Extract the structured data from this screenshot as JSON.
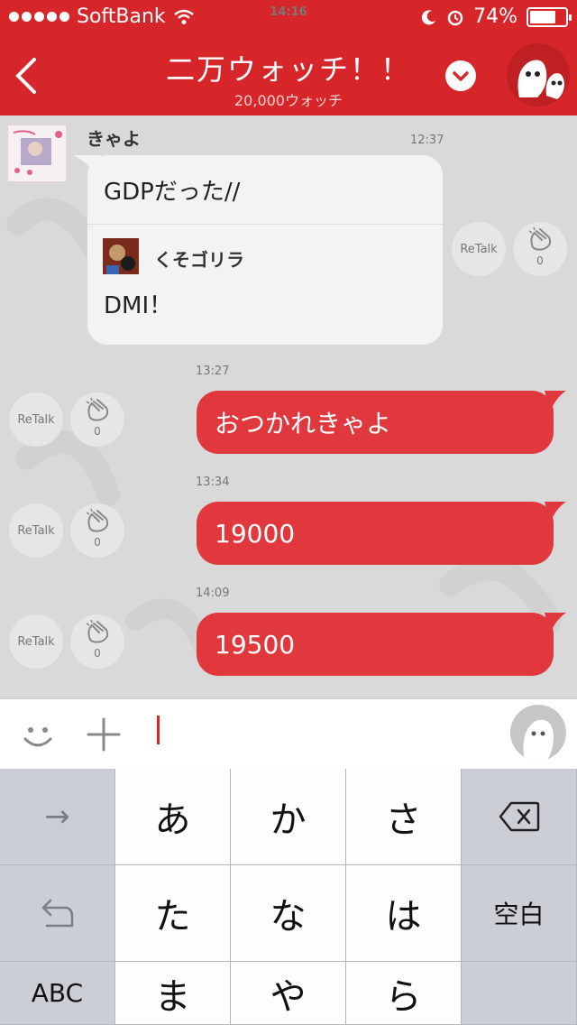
{
  "status_bar": {
    "carrier": "SoftBank",
    "time": "14:16",
    "battery": "74%",
    "battery_level": 0.74
  },
  "header": {
    "title": "二万ウォッチ！！",
    "subtitle": "20,000ウォッチ"
  },
  "messages": {
    "incoming": {
      "sender": "きゃよ",
      "time": "12:37",
      "text": "GDPだった//",
      "quote_name": "くそゴリラ",
      "quote_text": "DMI！",
      "retalk": "ReTalk",
      "clap_count": "0"
    },
    "outgoing": [
      {
        "time": "13:27",
        "text": "おつかれきゃよ",
        "retalk": "ReTalk",
        "clap_count": "0"
      },
      {
        "time": "13:34",
        "text": "19000",
        "retalk": "ReTalk",
        "clap_count": "0"
      },
      {
        "time": "14:09",
        "text": "19500",
        "retalk": "ReTalk",
        "clap_count": "0"
      }
    ]
  },
  "keyboard": {
    "rows": [
      [
        "→",
        "あ",
        "か",
        "さ",
        "⌫"
      ],
      [
        "↺",
        "た",
        "な",
        "は",
        "空白"
      ],
      [
        "ABC",
        "ま",
        "や",
        "ら",
        ""
      ]
    ]
  },
  "colors": {
    "brand": "#d7262a",
    "outgoing_bubble": "#e0383c",
    "chat_bg": "#d9d9d9"
  }
}
